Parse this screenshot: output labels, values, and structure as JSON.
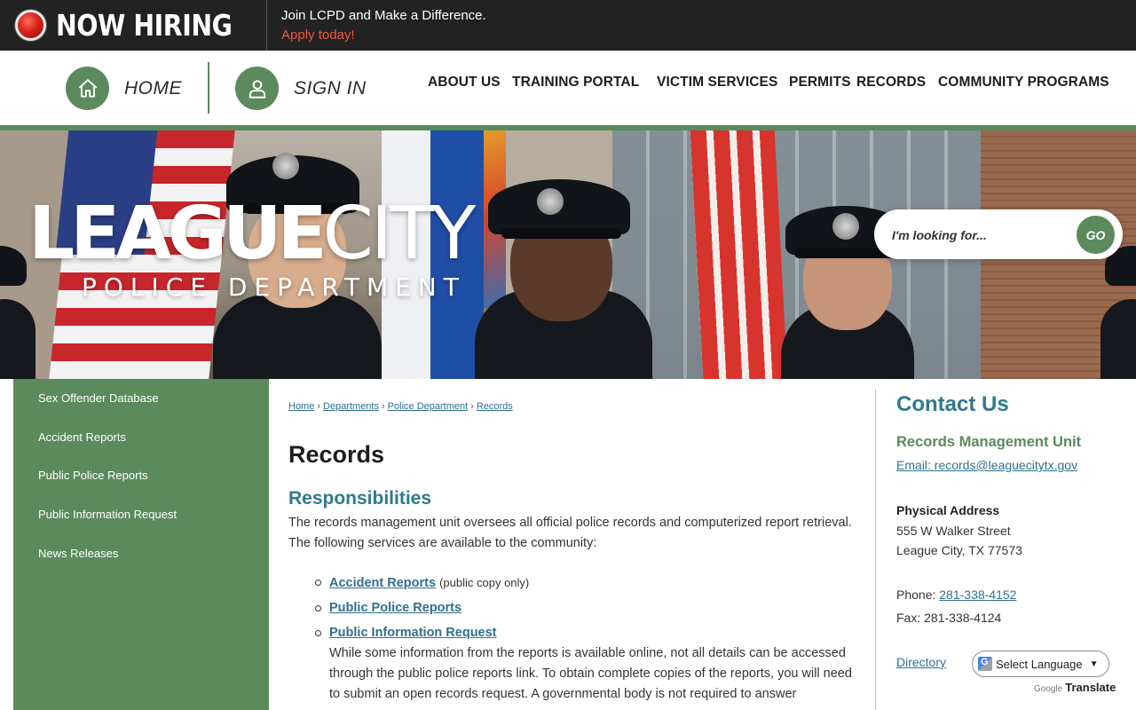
{
  "banner": {
    "headline": "NOW HIRING",
    "message": "Join LCPD and Make a Difference.",
    "cta": "Apply today!"
  },
  "header": {
    "home_label": "HOME",
    "signin_label": "SIGN IN",
    "nav": [
      "ABOUT US",
      "TRAINING PORTAL",
      "VICTIM SERVICES",
      "PERMITS",
      "RECORDS",
      "COMMUNITY PROGRAMS"
    ]
  },
  "hero": {
    "logo_bold": "LEAGUE",
    "logo_light": "CITY",
    "logo_sub": "POLICE DEPARTMENT",
    "search_placeholder": "I'm looking for...",
    "search_button": "GO"
  },
  "sidebar": {
    "items": [
      "Sex Offender Database",
      "Accident Reports",
      "Public Police Reports",
      "Public Information Request",
      "News Releases"
    ]
  },
  "breadcrumb": [
    "Home",
    "Departments",
    "Police Department",
    "Records"
  ],
  "content": {
    "title": "Records",
    "section_title": "Responsibilities",
    "intro": "The records management unit oversees all official police records and computerized report retrieval. The following services are available to the community:",
    "bullets": [
      {
        "link": "Accident Reports",
        "note": "(public copy only)",
        "desc": ""
      },
      {
        "link": "Public Police Reports",
        "note": "",
        "desc": ""
      },
      {
        "link": "Public Information Request",
        "note": "",
        "desc": "While some information from the reports is available online, not all details can be accessed through the public police reports link. To obtain complete copies of the reports, you will need to submit an open records request. A governmental body is not required to answer"
      }
    ]
  },
  "contact": {
    "title": "Contact Us",
    "unit": "Records Management Unit",
    "email": "Email: records@leaguecitytx.gov",
    "address_label": "Physical Address",
    "address_line1": "555 W Walker Street",
    "address_line2": "League City, TX 77573",
    "phone_label": "Phone:",
    "phone": "281-338-4152",
    "fax": "Fax: 281-338-4124",
    "directory": "Directory"
  },
  "translate": {
    "select_label": "Select Language",
    "powered_by": "Google",
    "translate_label": "Translate"
  },
  "colors": {
    "brand_green": "#5b8a5c",
    "heading_teal": "#2f7a8c",
    "link_blue": "#2f6f8f",
    "banner_dark": "#222222",
    "cta_orange": "#f05a3c"
  }
}
